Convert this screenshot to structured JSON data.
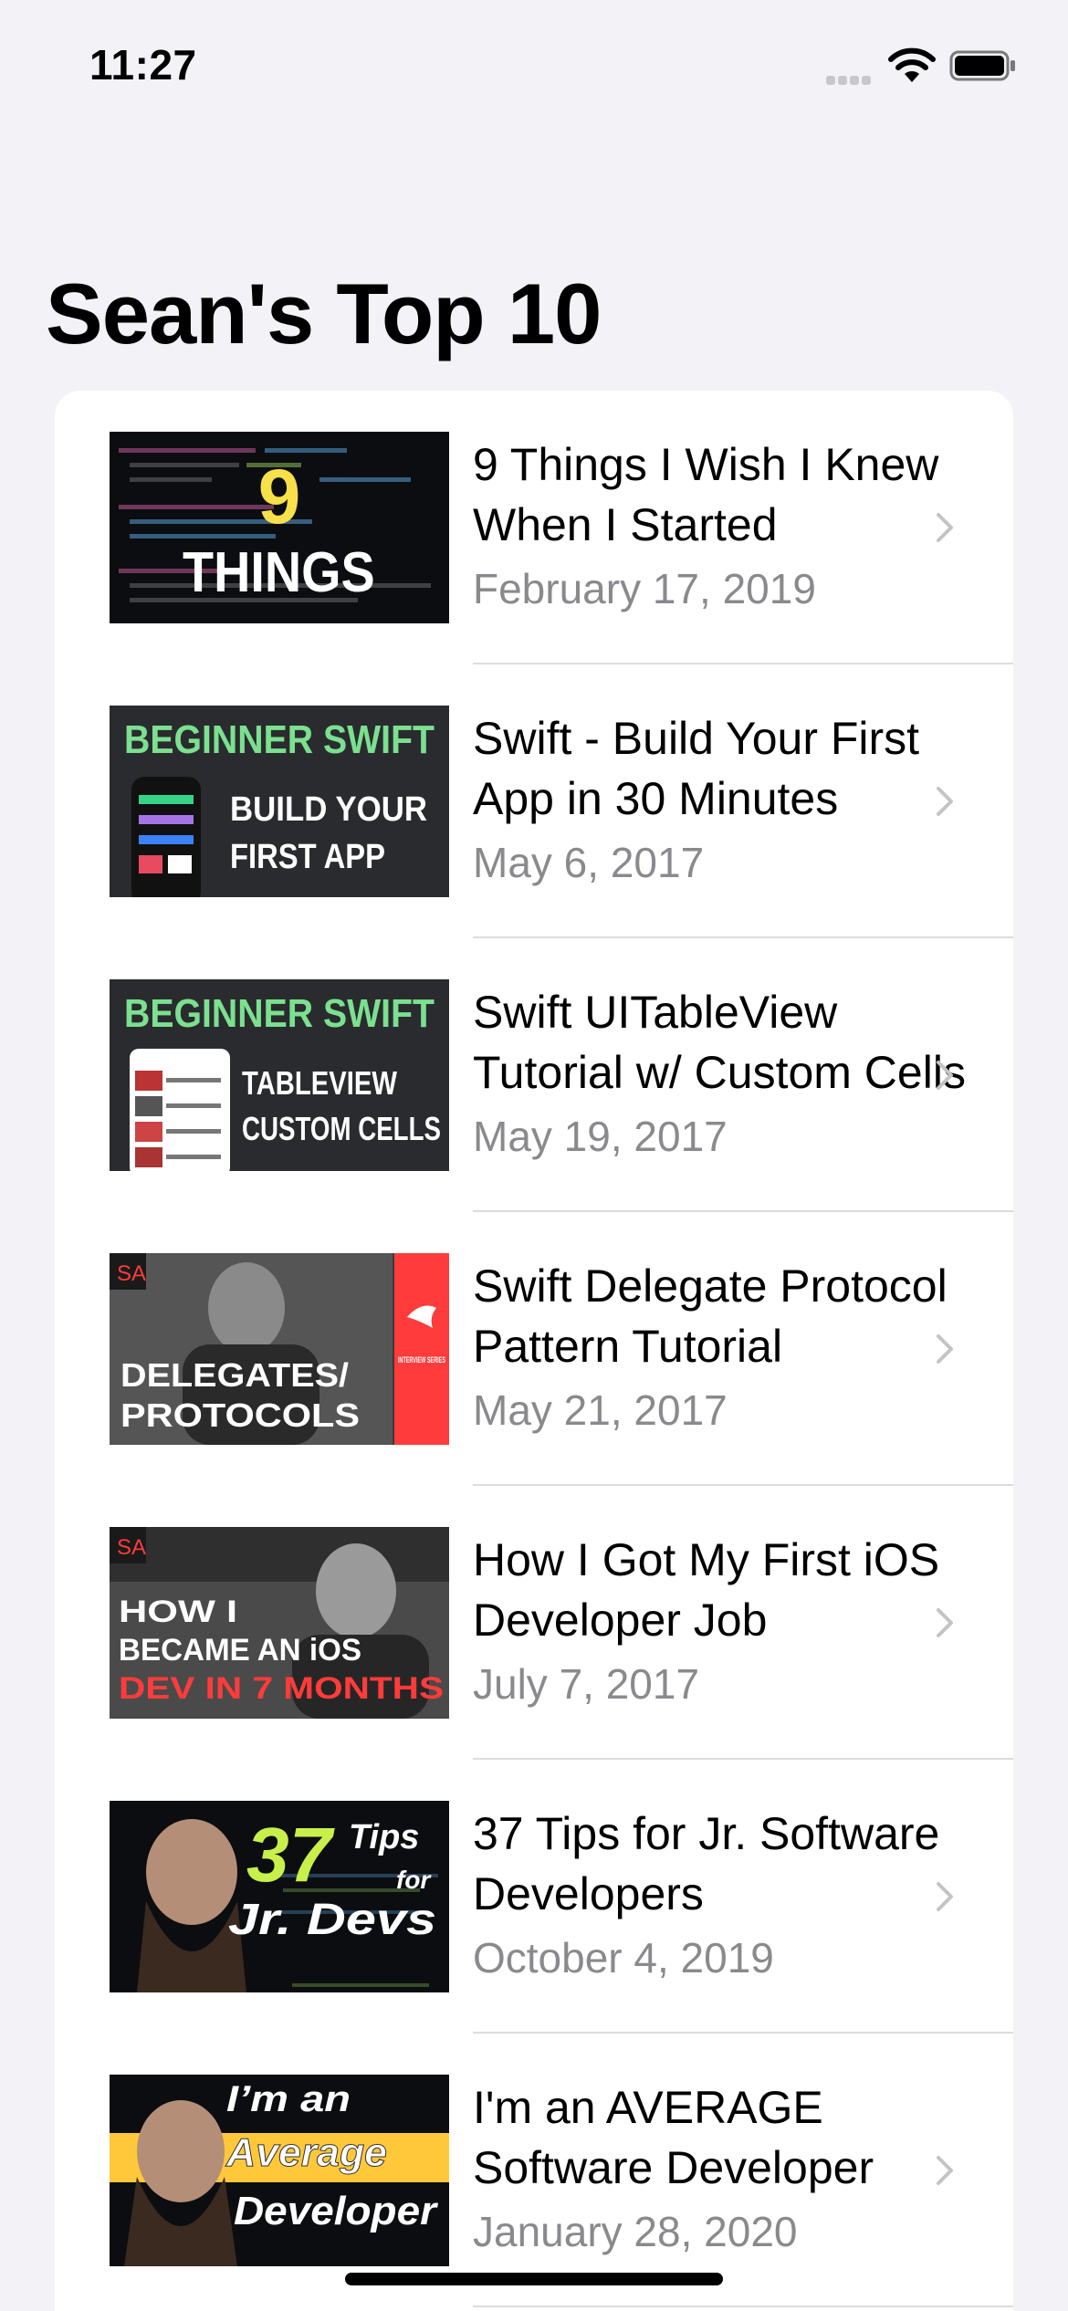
{
  "status_bar": {
    "time": "11:27"
  },
  "page": {
    "title": "Sean's Top 10"
  },
  "videos": [
    {
      "title": "9 Things I Wish I Knew When I Started",
      "date": "February 17, 2019",
      "thumb_text": [
        "9",
        "THINGS"
      ]
    },
    {
      "title": "Swift - Build Your First App in 30 Minutes",
      "date": "May 6, 2017",
      "thumb_text": [
        "BEGINNER SWIFT",
        "BUILD YOUR",
        "FIRST APP"
      ]
    },
    {
      "title": "Swift UITableView Tutorial w/ Custom Cells",
      "date": "May 19, 2017",
      "thumb_text": [
        "BEGINNER SWIFT",
        "TABLEVIEW",
        "CUSTOM CELLS"
      ]
    },
    {
      "title": "Swift Delegate Protocol Pattern Tutorial",
      "date": "May 21, 2017",
      "thumb_text": [
        "SA",
        "DELEGATES/",
        "PROTOCOLS",
        "INTERVIEW SERIES"
      ]
    },
    {
      "title": "How I Got My First iOS Developer Job",
      "date": "July 7, 2017",
      "thumb_text": [
        "SA",
        "HOW I",
        "BECAME AN iOS",
        "DEV IN 7 MONTHS"
      ]
    },
    {
      "title": "37 Tips for Jr. Software Developers",
      "date": "October 4, 2019",
      "thumb_text": [
        "37",
        "Tips",
        "for",
        "Jr. Devs"
      ]
    },
    {
      "title": "I'm an AVERAGE Software Developer",
      "date": "January 28, 2020",
      "thumb_text": [
        "I’m an",
        "Average",
        "Developer"
      ]
    }
  ],
  "colors": {
    "background": "#f2f2f7",
    "card": "#ffffff",
    "secondary_text": "#8a8a8e",
    "chevron": "#c4c4c7",
    "swift_green": "#7be08f",
    "accent_red": "#ff3b3b",
    "accent_yellow": "#ffd43b"
  }
}
